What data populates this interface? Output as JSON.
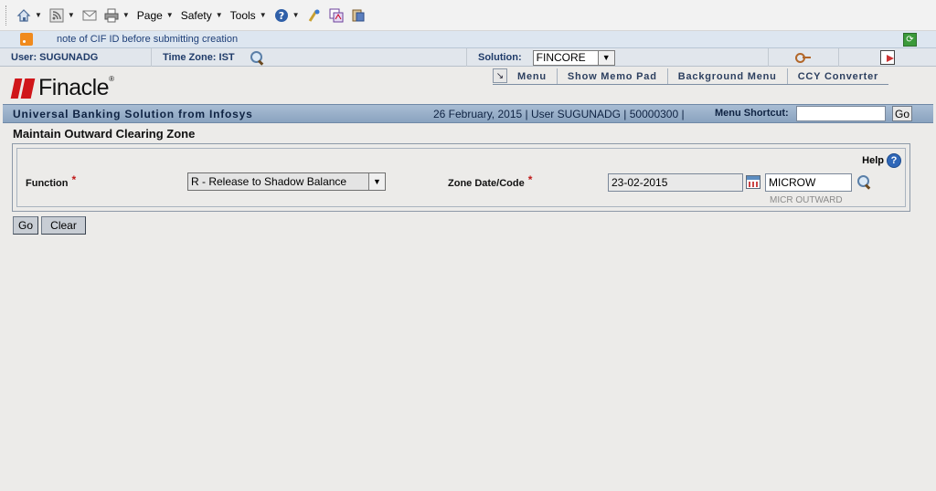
{
  "toolbar": {
    "home_icon": "home-icon",
    "feeds_icon": "rss-icon",
    "mail_icon": "mail-icon",
    "print_icon": "print-icon",
    "page_label": "Page",
    "safety_label": "Safety",
    "tools_label": "Tools",
    "help_icon": "help-icon",
    "research_icon": "research-icon",
    "translate_icon": "translate-icon",
    "bookmark_icon": "bookmark-icon"
  },
  "notification": {
    "text": "note of CIF ID before submitting creation"
  },
  "userbar": {
    "user": "User: SUGUNADG",
    "timezone": "Time Zone:  IST",
    "solution_label": "Solution:",
    "solution_value": "FINCORE"
  },
  "header": {
    "logo_text": "Finacle",
    "logo_reg": "®",
    "nav": [
      "Menu",
      "Show Memo Pad",
      "Background Menu",
      "CCY Converter"
    ]
  },
  "banner": {
    "title": "Universal Banking Solution from Infosys",
    "info": "26 February, 2015  |  User  SUGUNADG  |  50000300  |",
    "shortcut_label": "Menu Shortcut:",
    "shortcut_value": "",
    "go_label": "Go"
  },
  "page": {
    "title": "Maintain Outward Clearing Zone"
  },
  "form": {
    "help_label": "Help",
    "function_label": "Function",
    "function_value": "R - Release to Shadow Balance",
    "zone_label": "Zone Date/Code",
    "zone_date": "23-02-2015",
    "zone_code": "MICROW",
    "zone_code_desc": "MICR OUTWARD",
    "required_mark": "*"
  },
  "actions": {
    "go_label": "Go",
    "clear_label": "Clear"
  },
  "colors": {
    "banner_blue": "#8aa3bf",
    "brand_red": "#d0161a",
    "required_red": "#c01a1a"
  }
}
